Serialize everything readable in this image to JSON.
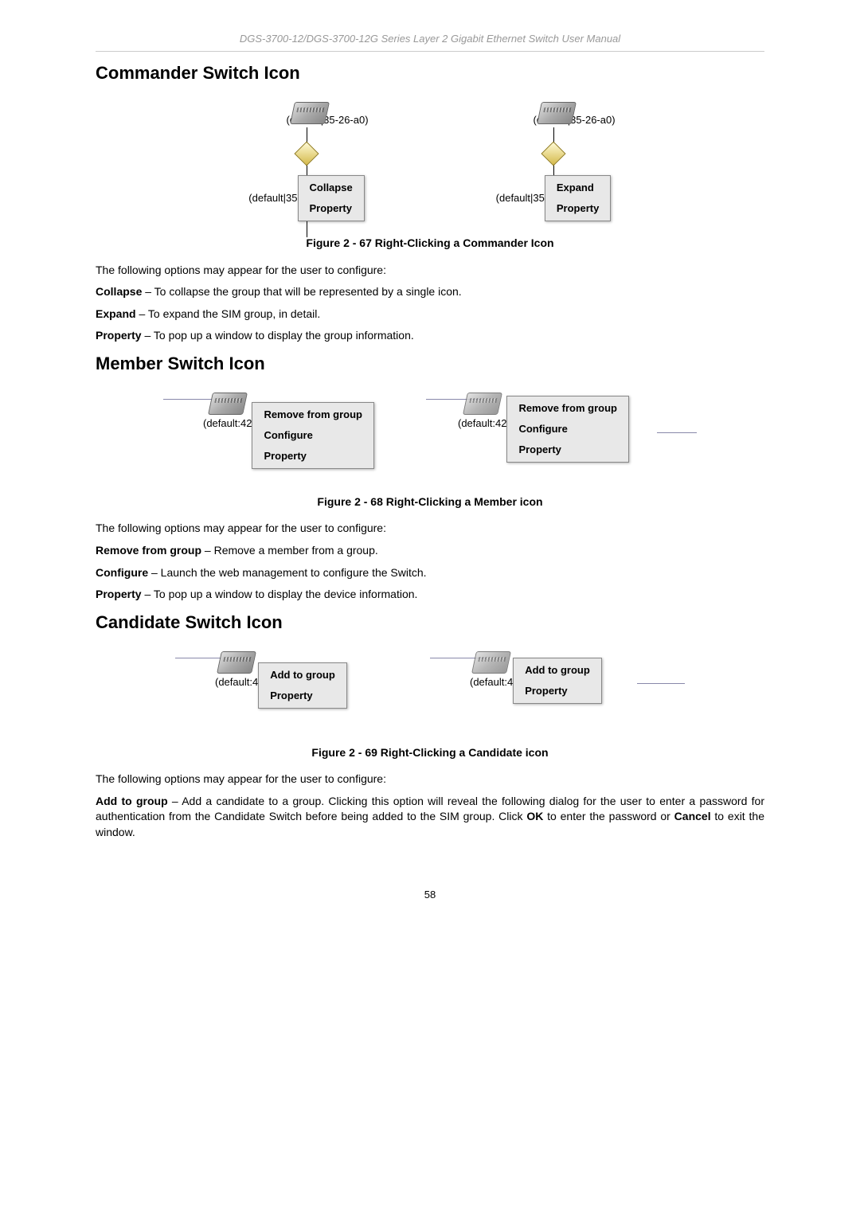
{
  "header": "DGS-3700-12/DGS-3700-12G Series Layer 2 Gigabit Ethernet Switch User Manual",
  "section1": {
    "heading": "Commander Switch Icon",
    "icon_label1": "(default|35-26-a0)",
    "icon_label2": "(default|35",
    "menu_left": {
      "item1": "Collapse",
      "item2": "Property"
    },
    "icon_label3": "(default|35-26-a0)",
    "icon_label4": "(default|35",
    "menu_right": {
      "item1": "Expand",
      "item2": "Property"
    },
    "caption": "Figure 2 - 67 Right-Clicking a Commander Icon",
    "p1": "The following options may appear for the user to configure:",
    "p2a": "Collapse",
    "p2b": " – To collapse the group that will be represented by a single icon.",
    "p3a": "Expand",
    "p3b": " – To expand the SIM group, in detail.",
    "p4a": "Property",
    "p4b": " – To pop up a window to display the group information."
  },
  "section2": {
    "heading": "Member Switch Icon",
    "icon_label1": "(default:42",
    "menu_left": {
      "item1": "Remove from group",
      "item2": "Configure",
      "item3": "Property"
    },
    "icon_label2": "(default:42",
    "menu_right": {
      "item1": "Remove from group",
      "item2": "Configure",
      "item3": "Property"
    },
    "caption": "Figure 2 - 68 Right-Clicking a Member icon",
    "p1": "The following options may appear for the user to configure:",
    "p2a": "Remove from group",
    "p2b": " – Remove a member from a group.",
    "p3a": "Configure",
    "p3b": " – Launch the web management to configure the Switch.",
    "p4a": "Property",
    "p4b": " – To pop up a window to display the device information."
  },
  "section3": {
    "heading": "Candidate Switch Icon",
    "icon_label1": "(default:4",
    "menu_left": {
      "item1": "Add to group",
      "item2": "Property"
    },
    "icon_label2": "(default:4",
    "menu_right": {
      "item1": "Add to group",
      "item2": "Property"
    },
    "caption": "Figure 2 - 69 Right-Clicking a Candidate icon",
    "p1": "The following options may appear for the user to configure:",
    "p2a": "Add to group",
    "p2b": " – Add a candidate to a group. Clicking this option will reveal the following dialog for the user to enter a password for authentication from the Candidate Switch before being added to the SIM group. Click ",
    "p2c": "OK",
    "p2d": " to enter the password or ",
    "p2e": "Cancel",
    "p2f": " to exit the window."
  },
  "page": "58"
}
